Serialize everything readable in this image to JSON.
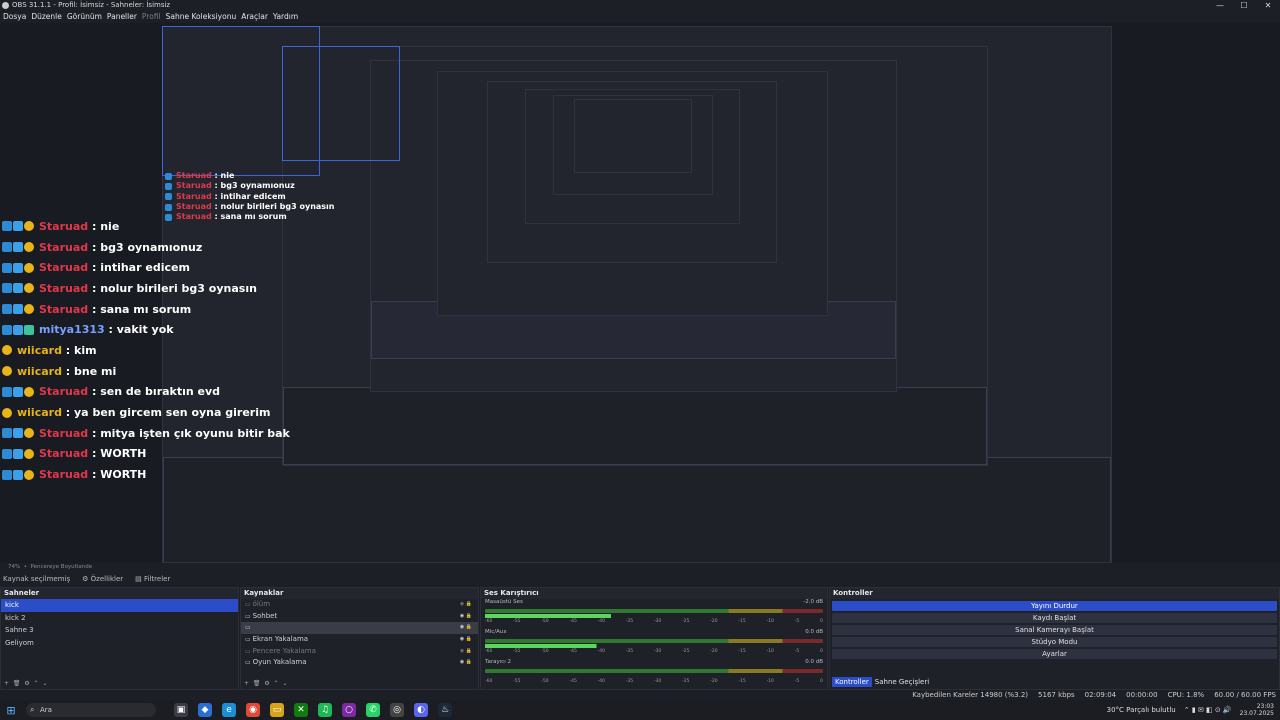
{
  "window": {
    "title": "OBS 31.1.1 - Profil: İsimsiz - Sahneler: İsimsiz",
    "controls": [
      "—",
      "☐",
      "✕"
    ]
  },
  "menu": {
    "items": [
      {
        "label": "Dosya",
        "disabled": false
      },
      {
        "label": "Düzenle",
        "disabled": false
      },
      {
        "label": "Görünüm",
        "disabled": false
      },
      {
        "label": "Paneller",
        "disabled": false
      },
      {
        "label": "Profil",
        "disabled": true
      },
      {
        "label": "Sahne Koleksiyonu",
        "disabled": false
      },
      {
        "label": "Araçlar",
        "disabled": false
      },
      {
        "label": "Yardım",
        "disabled": false
      }
    ]
  },
  "chat": [
    {
      "badges": [
        "blue",
        "cyan",
        "gold"
      ],
      "user": "Staruad",
      "color": "#e0384a",
      "text": "nie"
    },
    {
      "badges": [
        "blue",
        "cyan",
        "gold"
      ],
      "user": "Staruad",
      "color": "#e0384a",
      "text": "bg3 oynamıonuz"
    },
    {
      "badges": [
        "blue",
        "cyan",
        "gold"
      ],
      "user": "Staruad",
      "color": "#e0384a",
      "text": "intihar edicem"
    },
    {
      "badges": [
        "blue",
        "cyan",
        "gold"
      ],
      "user": "Staruad",
      "color": "#e0384a",
      "text": "nolur birileri bg3 oynasın"
    },
    {
      "badges": [
        "blue",
        "cyan",
        "gold"
      ],
      "user": "Staruad",
      "color": "#e0384a",
      "text": "sana mı sorum"
    },
    {
      "badges": [
        "blue",
        "cyan",
        "green"
      ],
      "user": "mitya1313",
      "color": "#7aa0ff",
      "text": "vakit yok"
    },
    {
      "badges": [
        "gold"
      ],
      "user": "wiicard",
      "color": "#e8b21a",
      "text": "kim"
    },
    {
      "badges": [
        "gold"
      ],
      "user": "wiicard",
      "color": "#e8b21a",
      "text": "bne mi"
    },
    {
      "badges": [
        "blue",
        "cyan",
        "gold"
      ],
      "user": "Staruad",
      "color": "#e0384a",
      "text": "sen de bıraktın evd"
    },
    {
      "badges": [
        "gold"
      ],
      "user": "wiicard",
      "color": "#e8b21a",
      "text": "ya ben gircem sen oyna girerim"
    },
    {
      "badges": [
        "blue",
        "cyan",
        "gold"
      ],
      "user": "Staruad",
      "color": "#e0384a",
      "text": "mitya işten çık oyunu bitir bak"
    },
    {
      "badges": [
        "blue",
        "cyan",
        "gold"
      ],
      "user": "Staruad",
      "color": "#e0384a",
      "text": "WORTH"
    },
    {
      "badges": [
        "blue",
        "cyan",
        "gold"
      ],
      "user": "Staruad",
      "color": "#e0384a",
      "text": "WORTH"
    }
  ],
  "scenebar": {
    "zoom": "74%",
    "mode": "Pencereye Boyutlande"
  },
  "toolbar": {
    "source_select": "Kaynak seçilmemiş",
    "properties": "Özellikler",
    "filters": "Filtreler"
  },
  "scenes": {
    "title": "Sahneler",
    "items": [
      "kick",
      "kick 2",
      "Sahne 3",
      "Geliyom"
    ],
    "selected": 0
  },
  "sources": {
    "title": "Kaynaklar",
    "items": [
      {
        "label": "ölüm",
        "grey": true
      },
      {
        "label": "Sohbet",
        "grey": false
      },
      {
        "label": "",
        "grey": false,
        "selbar": true
      },
      {
        "label": "Ekran Yakalama",
        "grey": false
      },
      {
        "label": "Pencere Yakalama",
        "grey": true
      },
      {
        "label": "Oyun Yakalama",
        "grey": false
      }
    ]
  },
  "mixer": {
    "title": "Ses Karıştırıcı",
    "channels": [
      {
        "name": "Masaüstü Ses",
        "db": "-2.0 dB",
        "level": 0.62
      },
      {
        "name": "Mic/Aux",
        "db": "0.0 dB",
        "level": 0.55
      },
      {
        "name": "Tarayıcı 2",
        "db": "0.0 dB",
        "level": 0.0
      }
    ],
    "ticks": [
      "-60",
      "-55",
      "-50",
      "-45",
      "-40",
      "-35",
      "-30",
      "-25",
      "-20",
      "-15",
      "-10",
      "-5",
      "0"
    ]
  },
  "controls": {
    "title": "Kontroller",
    "buttons": [
      "Yayını Durdur",
      "Kaydı Başlat",
      "Sanal Kamerayı Başlat",
      "Stüdyo Modu",
      "Ayarlar"
    ],
    "tabs": [
      "Kontroller",
      "Sahne Geçişleri"
    ]
  },
  "status": {
    "dropped": "Kaybedilen Kareler 14980 (%3.2)",
    "kbps": "5167 kbps",
    "live": "02:09:04",
    "rec": "00:00:00",
    "cpu": "CPU: 1.8%",
    "fps": "60.00 / 60.00 FPS"
  },
  "taskbar": {
    "search_placeholder": "Ara",
    "weather": "30°C  Parçalı bulutlu",
    "time": "23:03",
    "date": "23.07.2025"
  }
}
